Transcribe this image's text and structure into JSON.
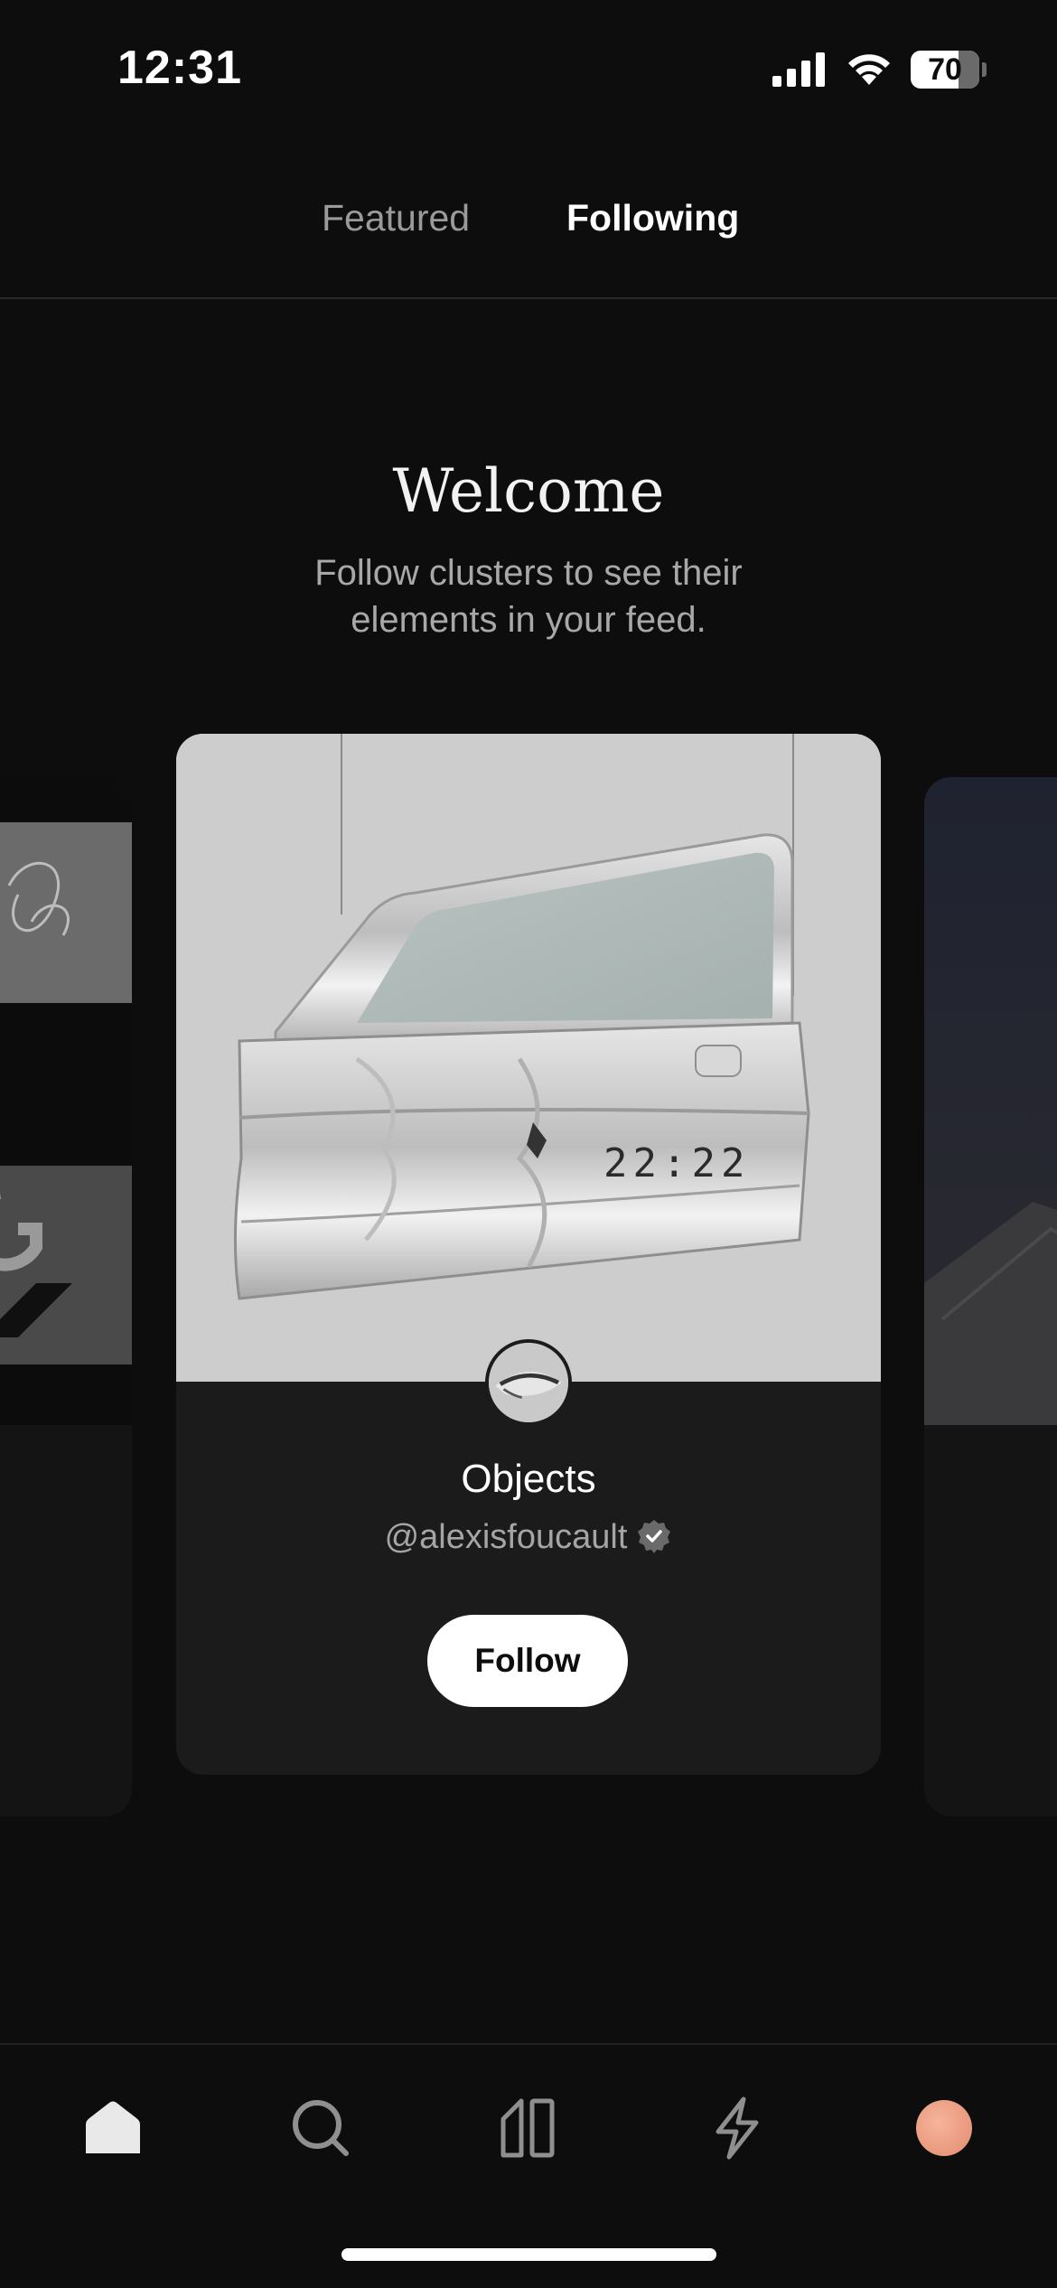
{
  "status_bar": {
    "time": "12:31",
    "battery_level": "70",
    "battery_fraction": 0.7,
    "icons": [
      "signal-icon",
      "wifi-icon",
      "battery-icon"
    ]
  },
  "top_tabs": [
    {
      "label": "Featured",
      "selected": false
    },
    {
      "label": "Following",
      "selected": true
    }
  ],
  "welcome": {
    "title": "Welcome",
    "subtitle": "Follow clusters to see their elements in your feed."
  },
  "cluster_card": {
    "title": "Objects",
    "handle": "@alexisfoucault",
    "verified": true,
    "follow_label": "Follow",
    "image_text": "22:22"
  },
  "bottom_nav": {
    "items": [
      "home-icon",
      "search-icon",
      "clusters-icon",
      "activity-icon",
      "profile-avatar"
    ],
    "selected": "home-icon"
  },
  "colors": {
    "background": "#0d0d0d",
    "card": "#1b1b1b",
    "primary_text": "#ffffff",
    "secondary_text": "#a5a5a5",
    "profile_accent": "#f0a688"
  }
}
